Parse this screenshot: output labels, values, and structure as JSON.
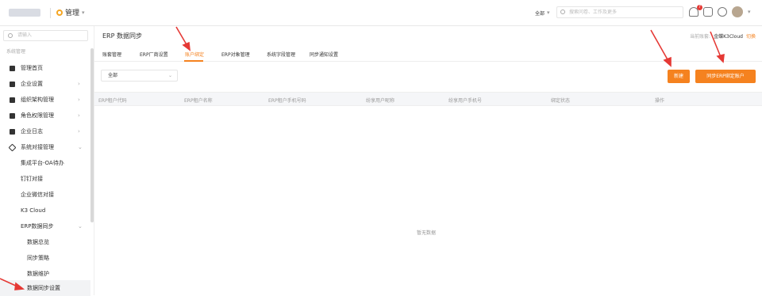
{
  "header": {
    "module_label": "管理",
    "scope_label": "全部",
    "search_placeholder": "搜索问卷、工作及更多",
    "notification_count": "7"
  },
  "sidebar": {
    "search_placeholder": "请输入",
    "section_label": "系统管理",
    "items": [
      {
        "label": "管理首页"
      },
      {
        "label": "企业设置"
      },
      {
        "label": "组织架构管理"
      },
      {
        "label": "角色权限管理"
      },
      {
        "label": "企业日志"
      },
      {
        "label": "系统对接管理"
      },
      {
        "label": "集成平台-OA待办"
      },
      {
        "label": "钉钉对接"
      },
      {
        "label": "企业微信对接"
      },
      {
        "label": "K3 Cloud"
      },
      {
        "label": "ERP数据同步"
      },
      {
        "label": "数据总览"
      },
      {
        "label": "同步策略"
      },
      {
        "label": "数据维护"
      },
      {
        "label": "数据同步设置"
      }
    ]
  },
  "main": {
    "title": "ERP 数据同步",
    "company_prefix": "当前账套:",
    "company_name": "金蝶K3Cloud",
    "company_switch": "切换",
    "tabs": [
      {
        "label": "账套管理"
      },
      {
        "label": "ERP厂商设置"
      },
      {
        "label": "账户绑定"
      },
      {
        "label": "ERP对象管理"
      },
      {
        "label": "系统字段管理"
      },
      {
        "label": "同步通知设置"
      }
    ],
    "filter_value": "全部",
    "new_button": "新建",
    "sync_button": "同步ERP绑定账户",
    "columns": [
      "ERP租户代码",
      "ERP租户名称",
      "ERP租户手机号码",
      "纷享用户昵称",
      "纷享用户手机号",
      "绑定状态",
      "操作"
    ],
    "empty_text": "暂无数据"
  },
  "colors": {
    "accent": "#f5821f",
    "annotation_arrow": "#e53935"
  }
}
